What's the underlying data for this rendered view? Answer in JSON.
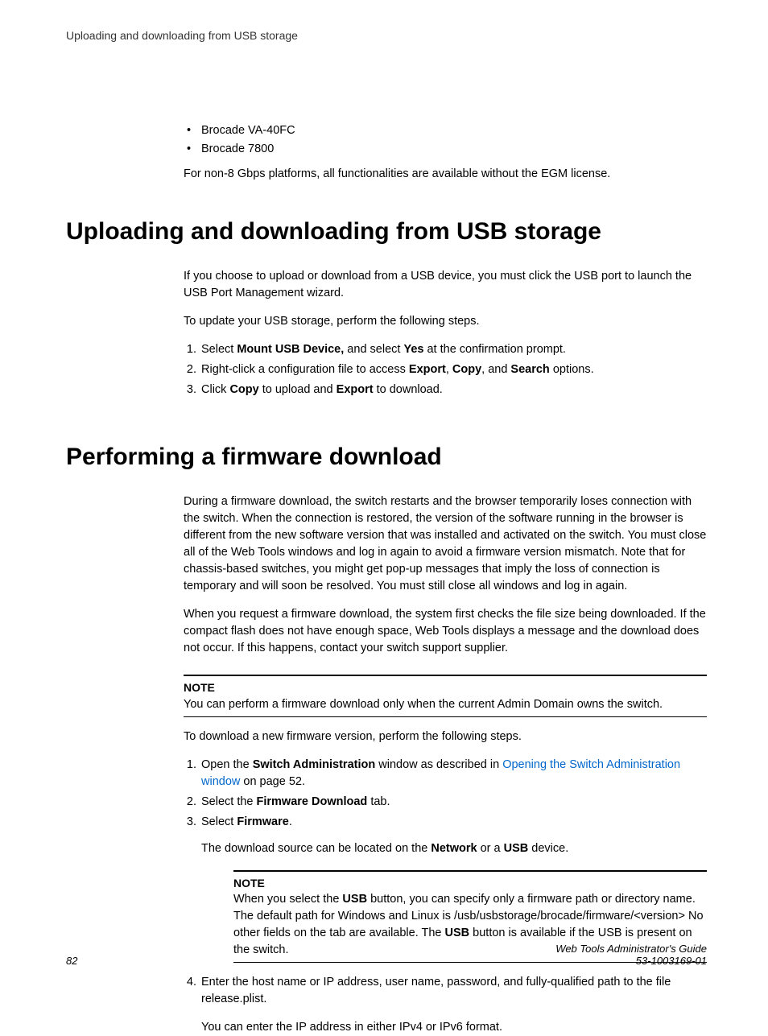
{
  "running_head": "Uploading and downloading from USB storage",
  "intro_list": [
    "Brocade VA-40FC",
    "Brocade 7800"
  ],
  "intro_para": "For non-8 Gbps platforms, all functionalities are available without the EGM license.",
  "sec1": {
    "title": "Uploading and downloading from USB storage",
    "p1": "If you choose to upload or download from a USB device, you must click the USB port to launch the USB Port Management wizard.",
    "p2": "To update your USB storage, perform the following steps.",
    "steps": {
      "s1a": "Select ",
      "s1b": "Mount USB Device,",
      "s1c": " and select ",
      "s1d": "Yes",
      "s1e": " at the confirmation prompt.",
      "s2a": "Right-click a configuration file to access ",
      "s2b": "Export",
      "s2c": ", ",
      "s2d": "Copy",
      "s2e": ", and ",
      "s2f": "Search",
      "s2g": " options.",
      "s3a": "Click ",
      "s3b": "Copy",
      "s3c": " to upload and ",
      "s3d": "Export",
      "s3e": " to download."
    }
  },
  "sec2": {
    "title": "Performing a firmware download",
    "p1": "During a firmware download, the switch restarts and the browser temporarily loses connection with the switch. When the connection is restored, the version of the software running in the browser is different from the new software version that was installed and activated on the switch. You must close all of the Web Tools windows and log in again to avoid a firmware version mismatch. Note that for chassis-based switches, you might get pop-up messages that imply the loss of connection is temporary and will soon be resolved. You must still close all windows and log in again.",
    "p2": "When you request a firmware download, the system first checks the file size being downloaded. If the compact flash does not have enough space, Web Tools displays a message and the download does not occur. If this happens, contact your switch support supplier.",
    "note1_title": "NOTE",
    "note1_body": "You can perform a firmware download only when the current Admin Domain owns the switch.",
    "p3": "To download a new firmware version, perform the following steps.",
    "steps": {
      "s1a": "Open the ",
      "s1b": "Switch Administration",
      "s1c": " window as described in ",
      "s1link": "Opening the Switch Administration window",
      "s1d": " on page 52.",
      "s2a": "Select the ",
      "s2b": "Firmware Download",
      "s2c": " tab.",
      "s3a": "Select ",
      "s3b": "Firmware",
      "s3c": ".",
      "s3sub_a": "The download source can be located on the ",
      "s3sub_b": "Network",
      "s3sub_c": " or a ",
      "s3sub_d": "USB",
      "s3sub_e": " device.",
      "note2_title": "NOTE",
      "note2_a": "When you select the ",
      "note2_b": "USB",
      "note2_c": " button, you can specify only a firmware path or directory name. The default path for Windows and Linux is /usb/usbstorage/brocade/firmware/<version> No other fields on the tab are available. The ",
      "note2_d": "USB",
      "note2_e": " button is available if the USB is present on the switch.",
      "s4": "Enter the host name or IP address, user name, password, and fully-qualified path to the file release.plist.",
      "s4sub": "You can enter the IP address in either IPv4 or IPv6 format."
    }
  },
  "footer": {
    "page": "82",
    "title": "Web Tools Administrator's Guide",
    "docnum": "53-1003169-01"
  }
}
